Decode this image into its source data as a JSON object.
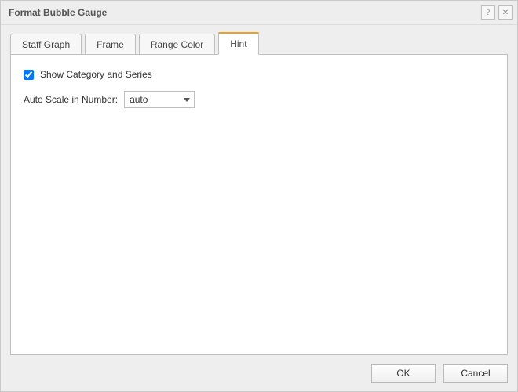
{
  "titlebar": {
    "title": "Format Bubble Gauge",
    "help": "?",
    "close": "✕"
  },
  "tabs": {
    "staff_graph": "Staff Graph",
    "frame": "Frame",
    "range_color": "Range Color",
    "hint": "Hint"
  },
  "hint_panel": {
    "show_category_series": {
      "label": "Show Category and Series",
      "checked": true
    },
    "auto_scale": {
      "label": "Auto Scale in Number:",
      "value": "auto"
    }
  },
  "footer": {
    "ok": "OK",
    "cancel": "Cancel"
  }
}
